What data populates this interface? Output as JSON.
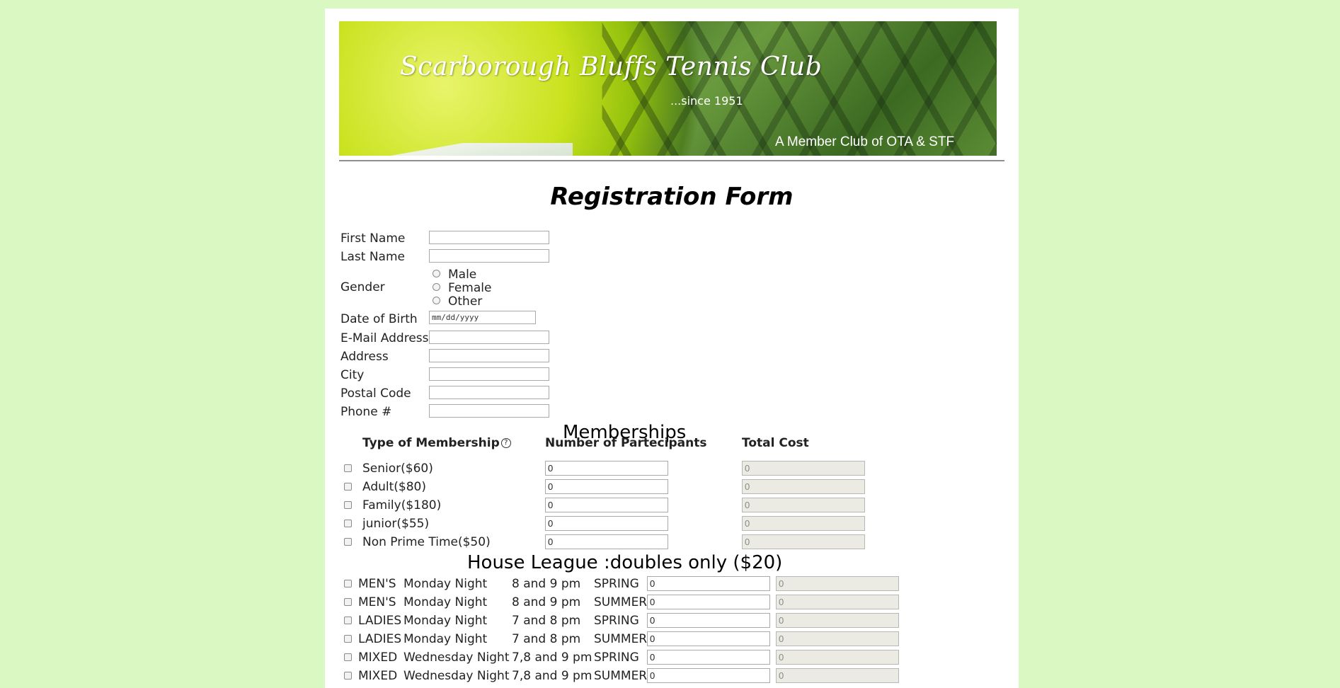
{
  "banner": {
    "club_name": "Scarborough Bluffs Tennis Club",
    "since": "...since 1951",
    "member": "A Member Club of OTA & STF"
  },
  "form_title": "Registration Form",
  "personal": {
    "first_name": "First Name",
    "last_name": "Last Name",
    "gender": "Gender",
    "gender_options": [
      "Male",
      "Female",
      "Other"
    ],
    "dob": "Date of Birth",
    "dob_placeholder": "mm/dd/yyyy",
    "email": "E-Mail Address",
    "address": "Address",
    "city": "City",
    "postal": "Postal Code",
    "phone": "Phone #"
  },
  "memberships": {
    "title": "Memberships",
    "col_type": "Type of Membership",
    "col_count": "Number of Partecipants",
    "col_cost": "Total Cost",
    "help_glyph": "?",
    "rows": [
      {
        "label": "Senior($60)",
        "count": "0",
        "cost": "0"
      },
      {
        "label": "Adult($80)",
        "count": "0",
        "cost": "0"
      },
      {
        "label": "Family($180)",
        "count": "0",
        "cost": "0"
      },
      {
        "label": "junior($55)",
        "count": "0",
        "cost": "0"
      },
      {
        "label": "Non Prime Time($50)",
        "count": "0",
        "cost": "0"
      }
    ]
  },
  "house_league": {
    "title": "House League :doubles only ($20)",
    "rows": [
      {
        "group": "MEN'S",
        "day": "Monday Night",
        "time": "8 and 9 pm",
        "season": "SPRING",
        "count": "0",
        "cost": "0"
      },
      {
        "group": "MEN'S",
        "day": "Monday Night",
        "time": "8 and 9 pm",
        "season": "SUMMER",
        "count": "0",
        "cost": "0"
      },
      {
        "group": "LADIES",
        "day": "Monday Night",
        "time": "7 and 8 pm",
        "season": "SPRING",
        "count": "0",
        "cost": "0"
      },
      {
        "group": "LADIES",
        "day": "Monday Night",
        "time": "7 and 8 pm",
        "season": "SUMMER",
        "count": "0",
        "cost": "0"
      },
      {
        "group": "MIXED",
        "day": "Wednesday Night",
        "time": "7,8 and 9 pm",
        "season": "SPRING",
        "count": "0",
        "cost": "0"
      },
      {
        "group": "MIXED",
        "day": "Wednesday Night",
        "time": "7,8 and 9 pm",
        "season": "SUMMER",
        "count": "0",
        "cost": "0"
      }
    ]
  }
}
